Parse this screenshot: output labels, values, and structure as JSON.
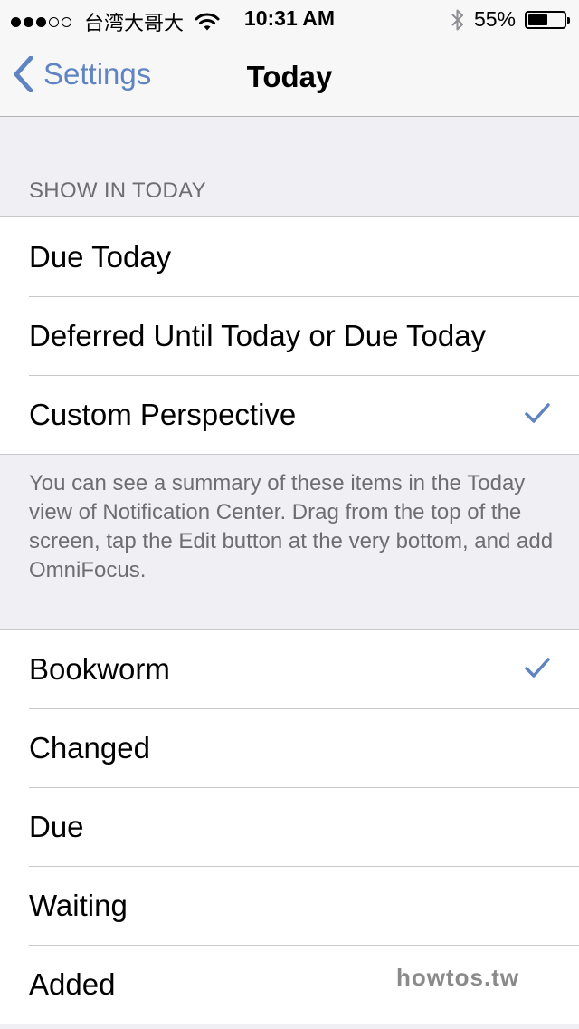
{
  "status_bar": {
    "signal_bars_filled": 3,
    "signal_bars_total": 5,
    "carrier": "台湾大哥大",
    "time": "10:31 AM",
    "battery_percent": "55%",
    "battery_level": 0.55
  },
  "nav": {
    "back_label": "Settings",
    "title": "Today"
  },
  "show_in_today": {
    "header": "SHOW IN TODAY",
    "options": [
      {
        "label": "Due Today",
        "checked": false
      },
      {
        "label": "Deferred Until Today or Due Today",
        "checked": false
      },
      {
        "label": "Custom Perspective",
        "checked": true
      }
    ],
    "footer": "You can see a summary of these items in the Today view of Notification Center. Drag from the top of the screen, tap the Edit button at the very bottom, and add OmniFocus."
  },
  "perspectives": [
    {
      "label": "Bookworm",
      "checked": true
    },
    {
      "label": "Changed",
      "checked": false
    },
    {
      "label": "Due",
      "checked": false
    },
    {
      "label": "Waiting",
      "checked": false
    },
    {
      "label": "Added",
      "checked": false
    }
  ],
  "watermark": "howtos.tw",
  "colors": {
    "tint": "#5f84c1",
    "background": "#efeff4",
    "secondary_text": "#6d6d72"
  }
}
